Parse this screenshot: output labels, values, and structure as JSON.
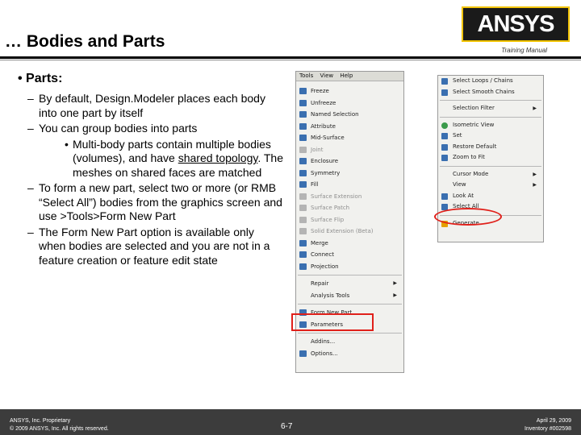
{
  "header": {
    "title": "… Bodies and Parts",
    "logo": "ANSYS",
    "training_label": "Training Manual"
  },
  "content": {
    "heading": "Parts:",
    "items": [
      {
        "level": 2,
        "text": "By default, Design.Modeler places each body into one part by itself"
      },
      {
        "level": 2,
        "text": "You can group bodies into parts"
      },
      {
        "level": 3,
        "pre": "Multi-body parts contain multiple bodies (volumes), and have ",
        "underlined": "shared topology",
        "post": ". The meshes on shared faces are matched"
      },
      {
        "level": 2,
        "text": "To form a new part, select two or more (or RMB “Select All”) bodies from the graphics screen and use >Tools>Form New Part"
      },
      {
        "level": 2,
        "text": "The Form New Part option is available only when bodies are selected and you are not in a feature creation or feature edit state"
      }
    ]
  },
  "tools_menu": {
    "menubar": [
      "Tools",
      "View",
      "Help"
    ],
    "items": [
      {
        "label": "Freeze",
        "disabled": false
      },
      {
        "label": "Unfreeze",
        "disabled": false
      },
      {
        "label": "Named Selection",
        "disabled": false
      },
      {
        "label": "Attribute",
        "disabled": false
      },
      {
        "label": "Mid-Surface",
        "disabled": false
      },
      {
        "label": "Joint",
        "disabled": true
      },
      {
        "label": "Enclosure",
        "disabled": false
      },
      {
        "label": "Symmetry",
        "disabled": false
      },
      {
        "label": "Fill",
        "disabled": false
      },
      {
        "label": "Surface Extension",
        "disabled": true
      },
      {
        "label": "Surface Patch",
        "disabled": true
      },
      {
        "label": "Surface Flip",
        "disabled": true
      },
      {
        "label": "Solid Extension (Beta)",
        "disabled": true
      },
      {
        "label": "Merge",
        "disabled": false
      },
      {
        "label": "Connect",
        "disabled": false
      },
      {
        "label": "Projection",
        "disabled": false
      }
    ],
    "items2": [
      {
        "label": "Repair",
        "submenu": true
      },
      {
        "label": "Analysis Tools",
        "submenu": true
      }
    ],
    "items3": [
      {
        "label": "Form New Part"
      },
      {
        "label": "Parameters"
      }
    ],
    "items4": [
      {
        "label": "Addins..."
      },
      {
        "label": "Options..."
      }
    ]
  },
  "context_menu": {
    "group1": [
      {
        "label": "Select Loops / Chains"
      },
      {
        "label": "Select Smooth Chains"
      }
    ],
    "group2": [
      {
        "label": "Selection Filter",
        "submenu": true
      }
    ],
    "group3": [
      {
        "label": "Isometric View"
      },
      {
        "label": "Set"
      },
      {
        "label": "Restore Default"
      },
      {
        "label": "Zoom to Fit"
      }
    ],
    "group4": [
      {
        "label": "Cursor Mode",
        "submenu": true
      },
      {
        "label": "View",
        "submenu": true
      },
      {
        "label": "Look At"
      },
      {
        "label": "Select All"
      }
    ],
    "group5": [
      {
        "label": "Generate"
      }
    ]
  },
  "footer": {
    "left1": "ANSYS, Inc. Proprietary",
    "left2": "© 2009 ANSYS, Inc. All rights reserved.",
    "center": "6-7",
    "right1": "April 29, 2009",
    "right2": "Inventory #002598"
  },
  "colors": {
    "highlight": "#e0201a",
    "footer_bg": "#3c3c3c",
    "logo_bg": "#1a1a1a",
    "logo_border": "#f2c400"
  }
}
